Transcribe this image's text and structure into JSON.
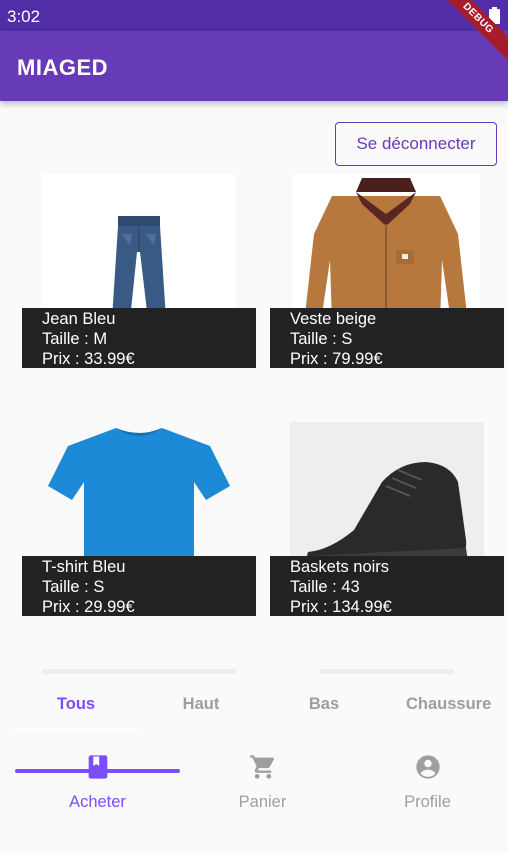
{
  "status": {
    "time": "3:02"
  },
  "debug_banner": "DEBUG",
  "app": {
    "title": "MIAGED"
  },
  "logout_label": "Se déconnecter",
  "products": [
    {
      "name": "Jean Bleu",
      "size": "Taille : M",
      "price": "Prix : 33.99€"
    },
    {
      "name": "Veste beige",
      "size": "Taille : S",
      "price": "Prix : 79.99€"
    },
    {
      "name": "T-shirt Bleu",
      "size": "Taille : S",
      "price": "Prix : 29.99€"
    },
    {
      "name": "Baskets noirs",
      "size": "Taille : 43",
      "price": "Prix : 134.99€"
    }
  ],
  "tabs": [
    {
      "label": "Tous",
      "active": true
    },
    {
      "label": "Haut",
      "active": false
    },
    {
      "label": "Bas",
      "active": false
    },
    {
      "label": "Chaussure",
      "active": false
    }
  ],
  "bottom_nav": [
    {
      "label": "Acheter",
      "icon": "book-icon",
      "active": true
    },
    {
      "label": "Panier",
      "icon": "cart-icon",
      "active": false
    },
    {
      "label": "Profile",
      "icon": "account-circle-icon",
      "active": false
    }
  ],
  "colors": {
    "primary": "#673ab7",
    "primary_dark": "#512da8",
    "accent": "#7c4dff",
    "inactive": "#9e9e9e",
    "caption_bg": "#222222"
  }
}
